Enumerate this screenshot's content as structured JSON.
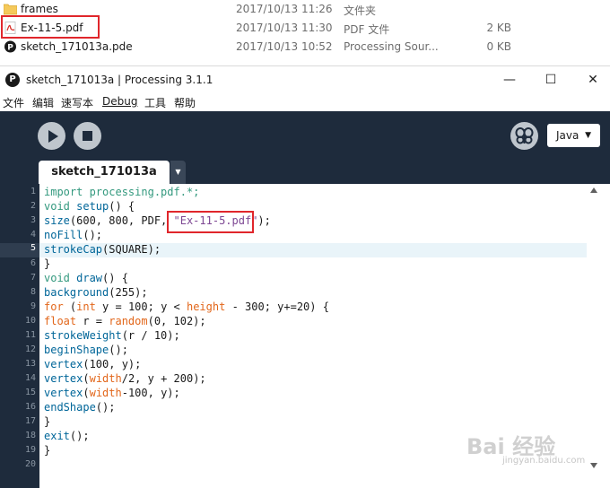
{
  "explorer": {
    "files": [
      {
        "name": "frames",
        "date": "2017/10/13 11:26",
        "type": "文件夹",
        "size": "",
        "icon": "folder-icon"
      },
      {
        "name": "Ex-11-5.pdf",
        "date": "2017/10/13 11:30",
        "type": "PDF 文件",
        "size": "2 KB",
        "icon": "pdf-icon"
      },
      {
        "name": "sketch_171013a.pde",
        "date": "2017/10/13 10:52",
        "type": "Processing Sour...",
        "size": "0 KB",
        "icon": "processing-file-icon"
      }
    ]
  },
  "window": {
    "title": "sketch_171013a | Processing 3.1.1",
    "app_icon_glyph": "P",
    "controls": {
      "minimize": "—",
      "maximize": "☐",
      "close": "✕"
    }
  },
  "menu": [
    "文件",
    "编辑",
    "速写本",
    "Debug",
    "工具",
    "帮助"
  ],
  "toolbar": {
    "run_icon": "play-icon",
    "stop_icon": "stop-icon",
    "debug_icon": "butterfly-icon",
    "mode": "Java",
    "mode_caret": "▼"
  },
  "tabs": [
    {
      "label": "sketch_171013a",
      "active": true
    }
  ],
  "tab_menu_glyph": "▼",
  "editor": {
    "current_line": 5,
    "line_numbers": [
      "1",
      "2",
      "3",
      "4",
      "5",
      "6",
      "7",
      "8",
      "9",
      "10",
      "11",
      "12",
      "13",
      "14",
      "15",
      "16",
      "17",
      "18",
      "19",
      "20"
    ],
    "colors": {
      "keyword": "#33997e",
      "function": "#006699",
      "builtin": "#e2661a",
      "string": "#7d4793",
      "background": "#1e2b3c"
    }
  },
  "watermark": {
    "text": "Bai 经验",
    "sub": "jingyan.baidu.com"
  }
}
